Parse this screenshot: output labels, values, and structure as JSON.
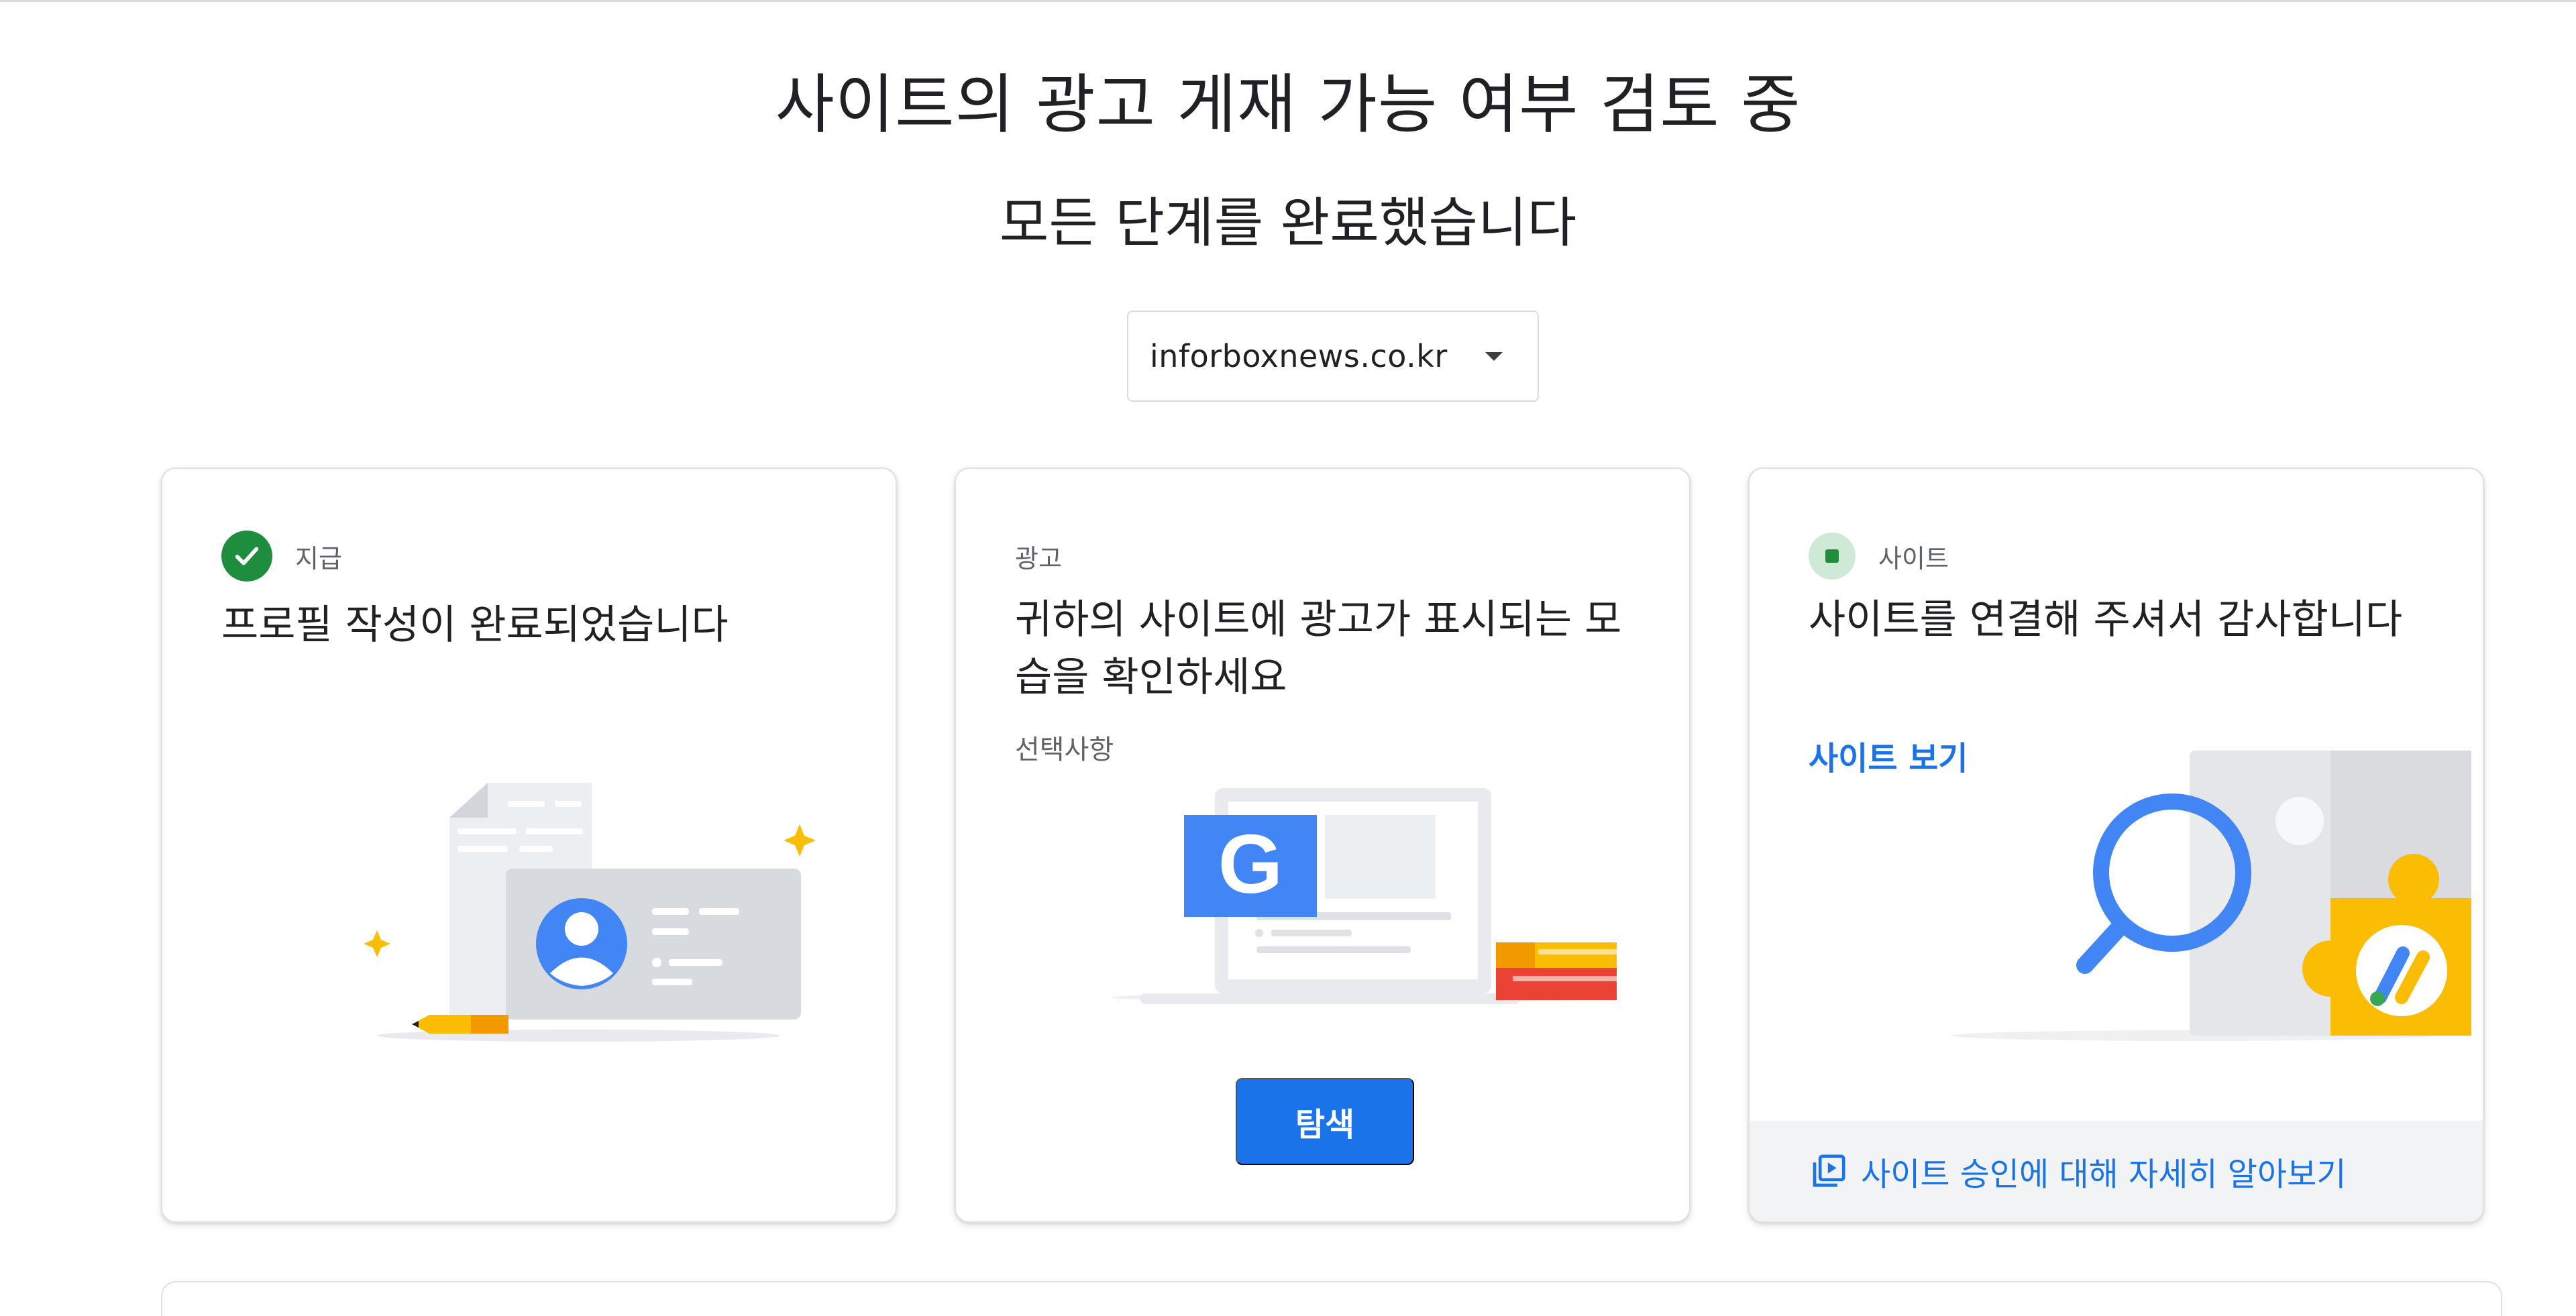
{
  "page": {
    "title": "사이트의 광고 게재 가능 여부 검토 중",
    "subtitle": "모든 단계를 완료했습니다"
  },
  "site_selector": {
    "value": "inforboxnews.co.kr"
  },
  "cards": [
    {
      "category": "지급",
      "status_icon": "check-circle-icon",
      "title": "프로필 작성이 완료되었습니다",
      "illustration": "profile-card-illustration"
    },
    {
      "category": "광고",
      "title": "귀하의 사이트에 광고가 표시되는 모습을 확인하세요",
      "optional_label": "선택사항",
      "button_label": "탐색",
      "illustration": "ad-preview-illustration"
    },
    {
      "category": "사이트",
      "status_icon": "site-status-icon",
      "title": "사이트를 연결해 주셔서 감사합니다",
      "link_label": "사이트 보기",
      "footer_link": "사이트 승인에 대해 자세히 알아보기",
      "footer_icon": "video-library-icon",
      "illustration": "site-review-illustration"
    }
  ],
  "colors": {
    "accent": "#1a73e8",
    "success": "#1e8e3e",
    "success_light": "#ceead6",
    "text_primary": "#202124",
    "text_secondary": "#5f6368",
    "google_yellow": "#fbbc04",
    "google_red": "#ea4335"
  }
}
